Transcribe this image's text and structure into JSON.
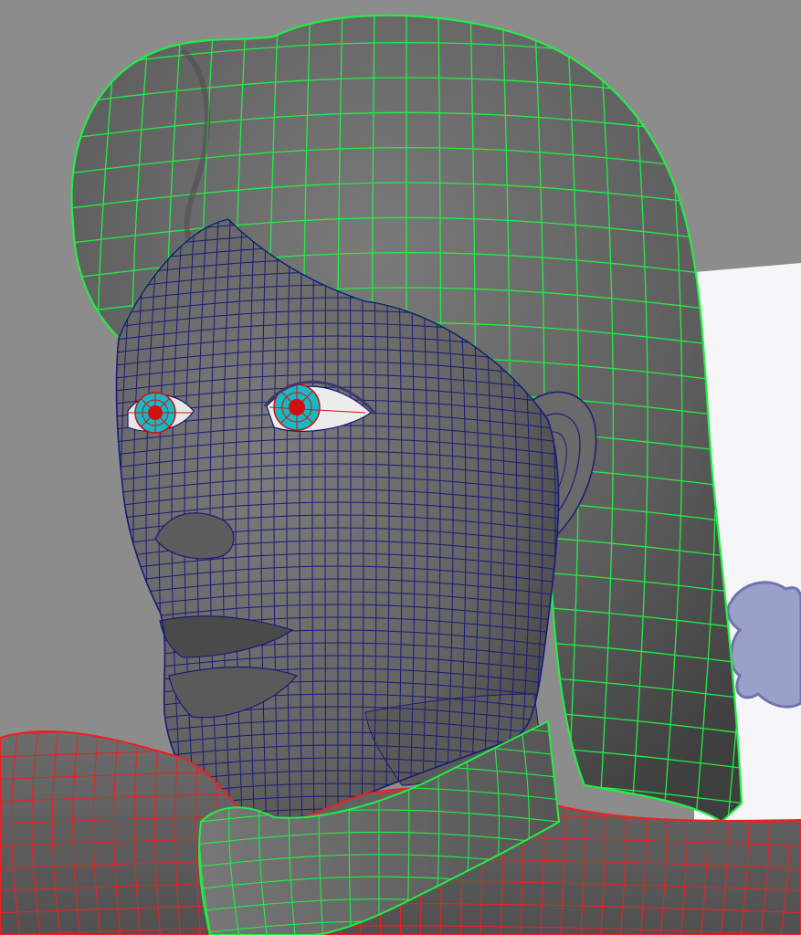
{
  "scene": {
    "colors": {
      "viewport_background": "#8c8c8c",
      "reference_plane": "#f6f6f8",
      "shaded_mesh": "#6a6a6a",
      "hair_wireframe": "#22ee44",
      "face_wireframe": "#1a1a78",
      "body_wireframe": "#ee2020",
      "iris": "#19b8c4",
      "pupil": "#d01010",
      "cloud_sketch": "#7b80b8"
    },
    "objects": [
      {
        "name": "hair",
        "wireframe_color": "green"
      },
      {
        "name": "head",
        "wireframe_color": "dark-blue"
      },
      {
        "name": "eyes",
        "wireframe_color": "red"
      },
      {
        "name": "collar",
        "wireframe_color": "green"
      },
      {
        "name": "shoulders",
        "wireframe_color": "red"
      }
    ]
  }
}
